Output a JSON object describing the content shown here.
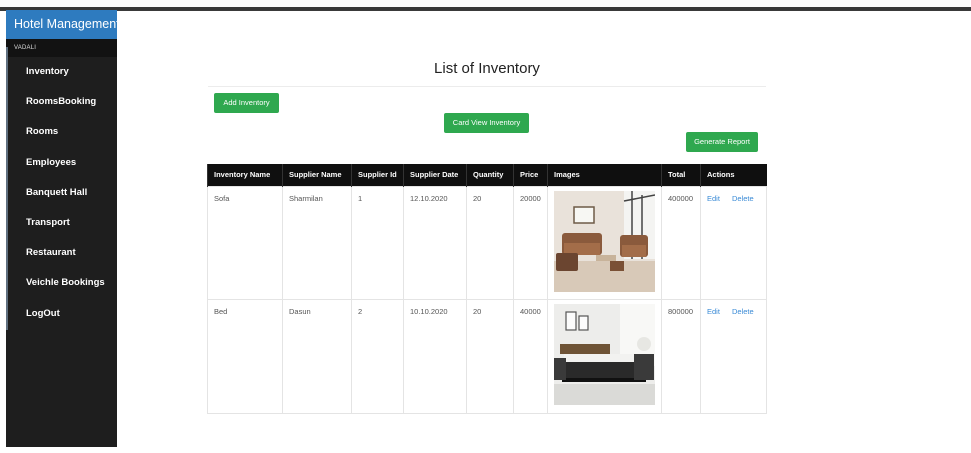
{
  "sidebar": {
    "brand": "Hotel Management",
    "subtitle": "VADALI",
    "items": [
      {
        "label": "Inventory"
      },
      {
        "label": "RoomsBooking"
      },
      {
        "label": "Rooms"
      },
      {
        "label": "Employees"
      },
      {
        "label": "Banquett Hall"
      },
      {
        "label": "Transport"
      },
      {
        "label": "Restaurant"
      },
      {
        "label": "Veichle Bookings"
      },
      {
        "label": "LogOut"
      }
    ]
  },
  "main": {
    "title": "List of Inventory",
    "add_button": "Add Inventory",
    "card_view_button": "Card View Inventory",
    "report_button": "Generate Report"
  },
  "table": {
    "headers": [
      "Inventory Name",
      "Supplier Name",
      "Supplier Id",
      "Supplier Date",
      "Quantity",
      "Price",
      "Images",
      "Total",
      "Actions"
    ],
    "edit_label": "Edit",
    "delete_label": "Delete",
    "rows": [
      {
        "name": "Sofa",
        "supplier": "Sharmilan",
        "supplier_id": "1",
        "date": "12.10.2020",
        "quantity": "20",
        "price": "20000",
        "image_icon": "sofa-photo",
        "total": "400000"
      },
      {
        "name": "Bed",
        "supplier": "Dasun",
        "supplier_id": "2",
        "date": "10.10.2020",
        "quantity": "20",
        "price": "40000",
        "image_icon": "bed-photo",
        "total": "800000"
      }
    ]
  },
  "colors": {
    "brand": "#2e7bbf",
    "sidebar": "#1e1e1e",
    "button": "#2fa84f",
    "link": "#3b8bd6",
    "table_header": "#0f0f0f"
  }
}
